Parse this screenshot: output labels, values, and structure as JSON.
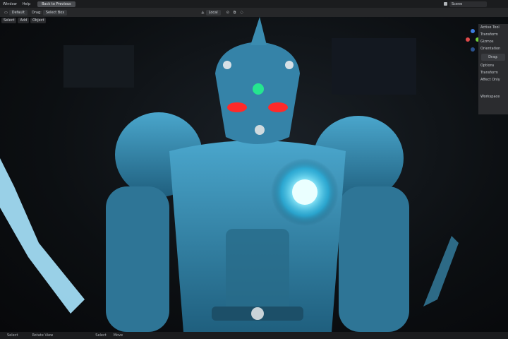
{
  "topbar": {
    "menus": [
      "Window",
      "Help"
    ],
    "back_button": "Back to Previous",
    "scene_label": "Scene"
  },
  "toolbar": {
    "mode": "Default",
    "drag_label": "Drag:",
    "drag_value": "Select Box",
    "orientation": "Local"
  },
  "header_menu": [
    "Select",
    "Add",
    "Object"
  ],
  "sidebar": {
    "active_tool_header": "Active Tool",
    "transform_label": "Transform",
    "gizmos_label": "Gizmos",
    "orientation_label": "Orientation",
    "drag_button": "Drag:",
    "options_header": "Options",
    "transform_sub": "Transform",
    "affect_only": "Affect Only",
    "workspace_header": "Workspace"
  },
  "status": {
    "item1": "Select",
    "item2": "Rotate View",
    "item3": "Select",
    "item4": "Move"
  },
  "colors": {
    "topbar": "#1b1c1e",
    "armor": "#3b8fb4",
    "glow": "#7fe6ff",
    "eyes": "#ff2a2a"
  }
}
